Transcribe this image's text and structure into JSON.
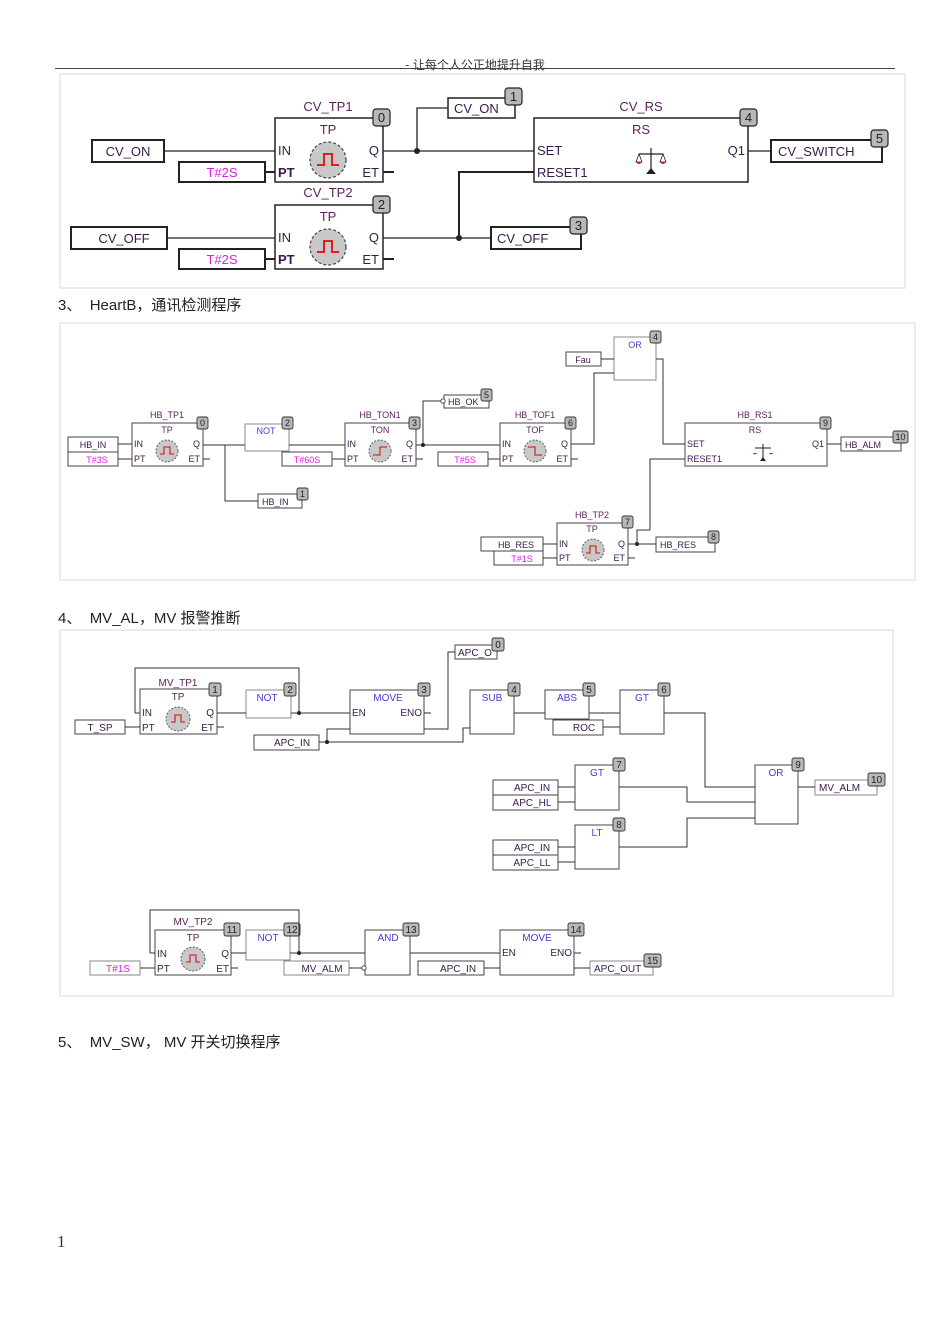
{
  "header": {
    "text": "- 让每个人公正地提升自我"
  },
  "sections": [
    {
      "number": "3、",
      "title": "HeartB，通讯检测程序"
    },
    {
      "number": "4、",
      "title": "MV_AL，MV 报警推断"
    },
    {
      "number": "5、",
      "title": "MV_SW，  MV 开关切换程序"
    }
  ],
  "page_number": "1",
  "colors": {
    "instance": "#5a1f5a",
    "time_literal": "#e020e0",
    "op": "#4a3ad0",
    "pin": "#3a1a4a",
    "badge_bg": "#b8b8b8",
    "clock_face": "#c8c8c8",
    "pulse": "#e02020"
  },
  "diagram1": {
    "blocks": {
      "tp1": {
        "instance": "CV_TP1",
        "type": "TP",
        "order": "0",
        "in": "IN",
        "pt": "PT",
        "q": "Q",
        "et": "ET"
      },
      "tp2": {
        "instance": "CV_TP2",
        "type": "TP",
        "order": "2",
        "in": "IN",
        "pt": "PT",
        "q": "Q",
        "et": "ET"
      },
      "rs": {
        "instance": "CV_RS",
        "type": "RS",
        "order": "4",
        "set": "SET",
        "reset": "RESET1",
        "q1": "Q1"
      }
    },
    "vars": {
      "cv_on_in": "CV_ON",
      "t2s_a": "T#2S",
      "cv_off_in": "CV_OFF",
      "t2s_b": "T#2S",
      "cv_on_out": "CV_ON",
      "cv_on_out_order": "1",
      "cv_off_out": "CV_OFF",
      "cv_off_out_order": "3",
      "cv_switch": "CV_SWITCH",
      "cv_switch_order": "5"
    }
  },
  "diagram2": {
    "blocks": {
      "tp1": {
        "instance": "HB_TP1",
        "type": "TP",
        "order": "0",
        "in": "IN",
        "pt": "PT",
        "q": "Q",
        "et": "ET"
      },
      "not": {
        "type": "NOT",
        "order": "2"
      },
      "ton1": {
        "instance": "HB_TON1",
        "type": "TON",
        "order": "3",
        "in": "IN",
        "pt": "PT",
        "q": "Q",
        "et": "ET"
      },
      "tof1": {
        "instance": "HB_TOF1",
        "type": "TOF",
        "order": "6",
        "in": "IN",
        "pt": "PT",
        "q": "Q",
        "et": "ET"
      },
      "or": {
        "type": "OR",
        "order": "4"
      },
      "rs1": {
        "instance": "HB_RS1",
        "type": "RS",
        "order": "9",
        "set": "SET",
        "reset": "RESET1",
        "q1": "Q1"
      },
      "tp2": {
        "instance": "HB_TP2",
        "type": "TP",
        "order": "7",
        "in": "IN",
        "pt": "PT",
        "q": "Q",
        "et": "ET"
      }
    },
    "vars": {
      "hb_in": "HB_IN",
      "t3s": "T#3S",
      "t60s": "T#60S",
      "t5s": "T#5S",
      "fau": "Fau",
      "hb_ok": "HB_OK",
      "hb_ok_order": "5",
      "hb_in_out": "HB_IN",
      "hb_in_out_order": "1",
      "hb_alm": "HB_ALM",
      "hb_alm_order": "10",
      "hb_res_in": "HB_RES",
      "t1s": "T#1S",
      "hb_res_out": "HB_RES",
      "hb_res_out_order": "8"
    }
  },
  "diagram3": {
    "blocks": {
      "tp1": {
        "instance": "MV_TP1",
        "type": "TP",
        "order": "1",
        "in": "IN",
        "pt": "PT",
        "q": "Q",
        "et": "ET"
      },
      "not1": {
        "type": "NOT",
        "order": "2"
      },
      "move1": {
        "type": "MOVE",
        "order": "3",
        "en": "EN",
        "eno": "ENO"
      },
      "sub": {
        "type": "SUB",
        "order": "4"
      },
      "abs": {
        "type": "ABS",
        "order": "5"
      },
      "gt1": {
        "type": "GT",
        "order": "6"
      },
      "gt2": {
        "type": "GT",
        "order": "7"
      },
      "lt": {
        "type": "LT",
        "order": "8"
      },
      "or": {
        "type": "OR",
        "order": "9"
      },
      "tp2": {
        "instance": "MV_TP2",
        "type": "TP",
        "order": "11",
        "in": "IN",
        "pt": "PT",
        "q": "Q",
        "et": "ET"
      },
      "not2": {
        "type": "NOT",
        "order": "12"
      },
      "and": {
        "type": "AND",
        "order": "13"
      },
      "move2": {
        "type": "MOVE",
        "order": "14",
        "en": "EN",
        "eno": "ENO"
      }
    },
    "vars": {
      "t_sp": "T_SP",
      "apc_in_1": "APC_IN",
      "apc_o": "APC_O",
      "apc_o_order": "0",
      "roc": "ROC",
      "apc_in_2": "APC_IN",
      "apc_hl": "APC_HL",
      "apc_in_3": "APC_IN",
      "apc_ll": "APC_LL",
      "mv_alm_out": "MV_ALM",
      "mv_alm_out_order": "10",
      "t1s": "T#1S",
      "mv_alm_in": "MV_ALM",
      "apc_in_4": "APC_IN",
      "apc_out": "APC_OUT",
      "apc_out_order": "15"
    }
  }
}
